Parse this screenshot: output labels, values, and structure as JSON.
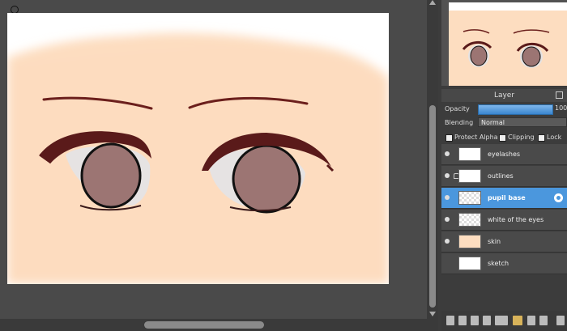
{
  "layers_panel": {
    "title": "Layer",
    "opacity_label": "Opacity",
    "opacity_value": "100",
    "opacity_fraction": 1.0,
    "blending_label": "Blending",
    "blending_value": "Normal",
    "protect_alpha_label": "Protect Alpha",
    "clipping_label": "Clipping",
    "lock_label": "Lock",
    "layers": [
      {
        "name": "eyelashes"
      },
      {
        "name": "outlines"
      },
      {
        "name": "pupil base"
      },
      {
        "name": "white of the eyes"
      },
      {
        "name": "skin"
      },
      {
        "name": "sketch"
      }
    ]
  },
  "colors": {
    "skin": "#fdddc0",
    "pupil": "#9c7573",
    "iris_outline": "#111111",
    "lash": "#5a1a1a",
    "selection": "#4b97dd"
  }
}
